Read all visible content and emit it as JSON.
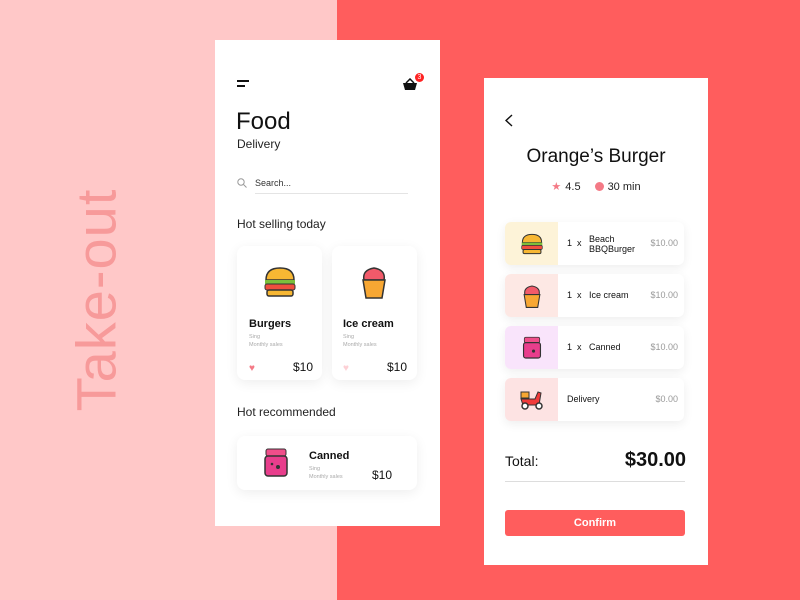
{
  "background_text": "Take-out",
  "colors": {
    "accent": "#ff5d5d",
    "light_pink": "#ffc8c8"
  },
  "home": {
    "cart_count": "3",
    "title": "Food",
    "subtitle": "Delivery",
    "search_placeholder": "Search...",
    "hot_selling_title": "Hot selling today",
    "hot_items": [
      {
        "name": "Burgers",
        "line1": "Sing",
        "line2": "Monthly sales",
        "price": "$10",
        "liked": true,
        "icon": "burger-icon"
      },
      {
        "name": "Ice cream",
        "line1": "Sing",
        "line2": "Monthly sales",
        "price": "$10",
        "liked": false,
        "icon": "cupcake-icon"
      }
    ],
    "recommended_title": "Hot recommended",
    "recommended": {
      "name": "Canned",
      "line1": "Sing",
      "line2": "Monthly sales",
      "price": "$10",
      "icon": "jar-icon"
    }
  },
  "order": {
    "restaurant": "Orange’s Burger",
    "rating": "4.5",
    "time": "30 min",
    "items": [
      {
        "qty": "1",
        "x": "x",
        "name_line1": "Beach",
        "name_line2": "BBQBurger",
        "price": "$10.00",
        "bg": "#fdf3d8",
        "icon": "burger-icon"
      },
      {
        "qty": "1",
        "x": "x",
        "name_line1": "Ice cream",
        "name_line2": "",
        "price": "$10.00",
        "bg": "#fde8e4",
        "icon": "cupcake-icon"
      },
      {
        "qty": "1",
        "x": "x",
        "name_line1": "Canned",
        "name_line2": "",
        "price": "$10.00",
        "bg": "#f9e4fb",
        "icon": "jar-icon"
      }
    ],
    "delivery": {
      "name": "Delivery",
      "price": "$0.00",
      "bg": "#fde3e3",
      "icon": "scooter-icon"
    },
    "total_label": "Total:",
    "total": "$30.00",
    "confirm": "Confirm"
  }
}
